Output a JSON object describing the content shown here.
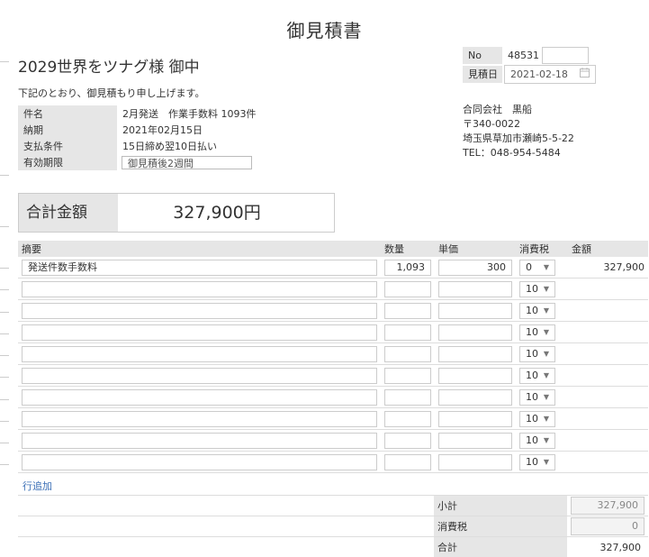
{
  "title": "御見積書",
  "client": "2029世界をツナグ様 御中",
  "greeting": "下記のとおり、御見積もり申し上げます。",
  "info": [
    {
      "label": "件名",
      "value": "2月発送　作業手数料 1093件"
    },
    {
      "label": "納期",
      "value": "2021年02月15日"
    },
    {
      "label": "支払条件",
      "value": "15日締め翌10日払い"
    },
    {
      "label": "有効期限",
      "value": "御見積後2週間"
    }
  ],
  "doc": {
    "no_label": "No",
    "no_value": "48531",
    "date_label": "見積日",
    "date_value": "2021-02-18",
    "date_icon": "calendar-icon"
  },
  "company": {
    "name": "合同会社　黒船",
    "zip": "〒340-0022",
    "address": "埼玉県草加市瀬崎5-5-22",
    "tel": "TEL：048-954-5484"
  },
  "total": {
    "label": "合計金額",
    "value": "327,900円"
  },
  "grid": {
    "headers": {
      "desc": "摘要",
      "qty": "数量",
      "price": "単価",
      "tax": "消費税",
      "amount": "金額"
    },
    "rows": [
      {
        "desc": "発送件数手数料",
        "qty": "1,093",
        "price": "300",
        "tax": "0",
        "amount": "327,900"
      },
      {
        "desc": "",
        "qty": "",
        "price": "",
        "tax": "10",
        "amount": ""
      },
      {
        "desc": "",
        "qty": "",
        "price": "",
        "tax": "10",
        "amount": ""
      },
      {
        "desc": "",
        "qty": "",
        "price": "",
        "tax": "10",
        "amount": ""
      },
      {
        "desc": "",
        "qty": "",
        "price": "",
        "tax": "10",
        "amount": ""
      },
      {
        "desc": "",
        "qty": "",
        "price": "",
        "tax": "10",
        "amount": ""
      },
      {
        "desc": "",
        "qty": "",
        "price": "",
        "tax": "10",
        "amount": ""
      },
      {
        "desc": "",
        "qty": "",
        "price": "",
        "tax": "10",
        "amount": ""
      },
      {
        "desc": "",
        "qty": "",
        "price": "",
        "tax": "10",
        "amount": ""
      },
      {
        "desc": "",
        "qty": "",
        "price": "",
        "tax": "10",
        "amount": ""
      }
    ]
  },
  "add_row": "行追加",
  "summary": {
    "subtotal_label": "小計",
    "subtotal": "327,900",
    "tax_label": "消費税",
    "tax": "0",
    "total_label": "合計",
    "total": "327,900"
  }
}
